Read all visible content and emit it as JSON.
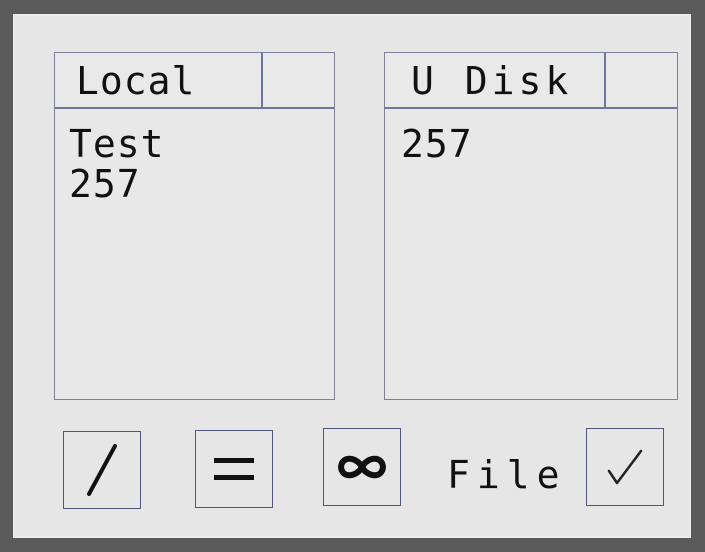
{
  "local_panel": {
    "title": "Local",
    "header_extra": "",
    "files": [
      "Test",
      "257"
    ]
  },
  "udisk_panel": {
    "title": "U Disk",
    "header_extra": "",
    "files": [
      "257"
    ]
  },
  "toolbar": {
    "slash_icon": "slash-icon",
    "equal_icon": "equal-icon",
    "infinity_icon": "infinity-icon",
    "file_label": "File",
    "check_icon": "check-icon"
  },
  "colors": {
    "bezel": "#5a5a5a",
    "screen": "#e6e6e6",
    "border": "#6f73a0",
    "text": "#111111"
  }
}
